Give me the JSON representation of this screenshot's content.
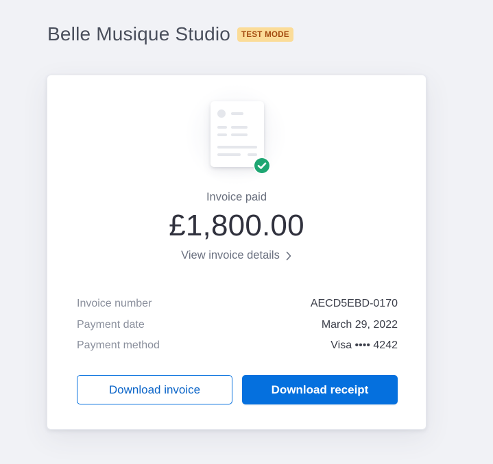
{
  "header": {
    "merchant_name": "Belle Musique Studio",
    "badge": "TEST MODE"
  },
  "receipt": {
    "status": "Invoice paid",
    "amount": "£1,800.00",
    "details_link": "View invoice details",
    "icons": {
      "document": "invoice-document-icon",
      "check": "check-circle-icon",
      "chevron": "chevron-right-icon"
    },
    "info": [
      {
        "label": "Invoice number",
        "value": "AECD5EBD-0170"
      },
      {
        "label": "Payment date",
        "value": "March 29, 2022"
      },
      {
        "label": "Payment method",
        "value": "Visa •••• 4242"
      }
    ],
    "download_invoice_label": "Download invoice",
    "download_receipt_label": "Download receipt"
  },
  "colors": {
    "accent": "#0570de",
    "success": "#1ea672",
    "badge_bg": "#fbdc98",
    "badge_text": "#a34a0f",
    "page_bg": "#f1f2f6"
  }
}
